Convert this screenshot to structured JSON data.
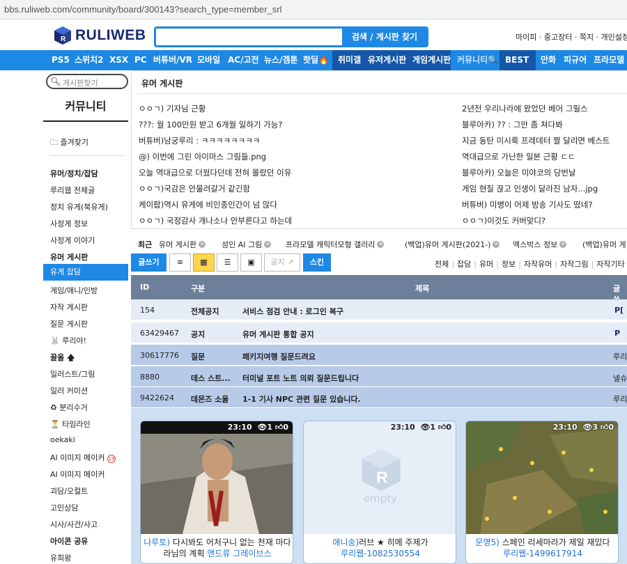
{
  "browser": {
    "url": "bbs.ruliweb.com/community/board/300143?search_type=member_srl"
  },
  "header": {
    "logo_text": "RULIWEB",
    "search_button": "검색 / 게시판 찾기",
    "top_links": "마이피 · 중고장터 · 쪽지 · 개인설정"
  },
  "nav": [
    "PS5",
    "스위치2",
    "XSX",
    "PC",
    "버튜버/VR",
    "모바일",
    "AC/고전",
    "뉴스/겜툰",
    "핫딜🔥",
    "취미갤",
    "유저게시판",
    "게임게시판",
    "커뮤니티🔍",
    "BEST",
    "만화",
    "피규어",
    "프라모델"
  ],
  "sidebar": {
    "search_placeholder": "게시판찾기",
    "title": "커뮤니티",
    "favorites": "즐겨찾기",
    "items": [
      "유머/정치/잡담",
      "루리웹 전체글",
      "정치 유게(북유게)",
      "사정게 정보",
      "사정게 이야기",
      "유머 게시판",
      "유게 잡담",
      "게임/애니/인방",
      "자작 게시판",
      "질문 게시판",
      "🐰 루리야!",
      "끌올",
      "일러스트/그림",
      "일러 커미션",
      "♻ 분리수거",
      "⏳ 타임라인",
      "oekaki",
      "AI 이미지 메이커",
      "AI 이미지 메이커",
      "괴담/오컬트",
      "고민상담",
      "시사/사건/사고",
      "아이콘 공유",
      "유희왕"
    ]
  },
  "board": {
    "title": "유머 게시판",
    "hot_left": [
      "ㅇㅇㄱ) 기자님 근황",
      "???: 월 100만원 받고 6개월 일하기 가능?",
      "버튜버)남궁루리 : ㅋㅋㅋㅋㅋㅋㅋㅋ",
      "@) 이번에 그린 아이마스 그림들.png",
      "오늘 역대급으로 더웠다던데 전혀 몰랐던 이유",
      "ㅇㅇㄱ)국감은 안물려갈거 같긴함",
      "케이팝)역시 유게에 비인종인간이 넘 많다",
      "ㅇㅇㄱ) 국정감사 개나소나 안부른다고 하는데"
    ],
    "hot_right": [
      "2년전 우리나라에 왔었던 베어 그릴스",
      "블루아카) ?? : 그만 좀 쳐다봐",
      "지금 동탄 미시룩 프레데터 짤 달리면 베스트",
      "역대급으로 가난한 일본 근황 ㄷㄷ",
      "블루아카) 오늘은 미야코의 당번날",
      "게임 현질 끊고 인생이 달라진 남자...jpg",
      "버튜버) 미병이 어제 방송 기사도 떴네?",
      "ㅇㅇㄱ)이것도 커버맞디?"
    ]
  },
  "recent": {
    "label": "최근",
    "items": [
      "유머 게시판",
      "성인 AI 그림",
      "프라모델 캐릭터모형 갤러리",
      "(백업)유머 게시판(2021-)",
      "엑스박스 정보",
      "(백업)유머 게"
    ]
  },
  "toolbar": {
    "write": "글쓰기",
    "notice": "공지 ↗",
    "skin": "스킨",
    "categories": [
      "전체",
      "잡담",
      "유머",
      "정보",
      "자작유머",
      "자작그림",
      "자작기타"
    ]
  },
  "table": {
    "headers": {
      "id": "ID",
      "category": "구분",
      "title": "제목",
      "author": "글쓴"
    },
    "rows": [
      {
        "id": "154",
        "category": "전체공지",
        "title": "서비스 점검 안내 : 로그인 복구",
        "author": "P[",
        "type": "notice"
      },
      {
        "id": "63429467",
        "category": "공지",
        "title": "유머 게시판 통합 공지",
        "author": "P",
        "type": "notice"
      },
      {
        "id": "30617776",
        "category": "질문",
        "title": "패키지여행 질문드려요",
        "author": "루리",
        "type": "best"
      },
      {
        "id": "8880",
        "category": "데스 스트...",
        "title": "터미널 포트 노트 의뢰 질문드립니다",
        "author": "넬슈",
        "type": "best"
      },
      {
        "id": "9422624",
        "category": "데몬즈 소울",
        "title": "1-1 기사 NPC 관련 질문 있습니다.",
        "author": "루리",
        "type": "best"
      }
    ]
  },
  "cards": [
    {
      "time": "23:10",
      "views": "1",
      "likes": "0",
      "tag": "나루토)",
      "title": "다시봐도 어처구니 없는 천재 마다라님의 계획",
      "author": "앤드류 그레이브스",
      "thumb": "manga"
    },
    {
      "time": "23:10",
      "views": "1",
      "likes": "0",
      "tag": "애니송)",
      "title": "러브 ★ 히메 주제가",
      "author": "루리웹-1082530554",
      "thumb": "empty",
      "empty_text": "empty"
    },
    {
      "time": "23:10",
      "views": "3",
      "likes": "0",
      "tag": "문명5)",
      "title": "스페인 리세마라가 제일 재밌다",
      "author": "루리웹-1499617914",
      "thumb": "map"
    }
  ],
  "colors": {
    "accent": "#1e88e5",
    "nav_dark": "#1457a8",
    "table_head": "#6d7f99",
    "notice_row": "#e6ecf6",
    "best_row": "#b7cbe9",
    "gallery_bg": "#cfdff2"
  }
}
